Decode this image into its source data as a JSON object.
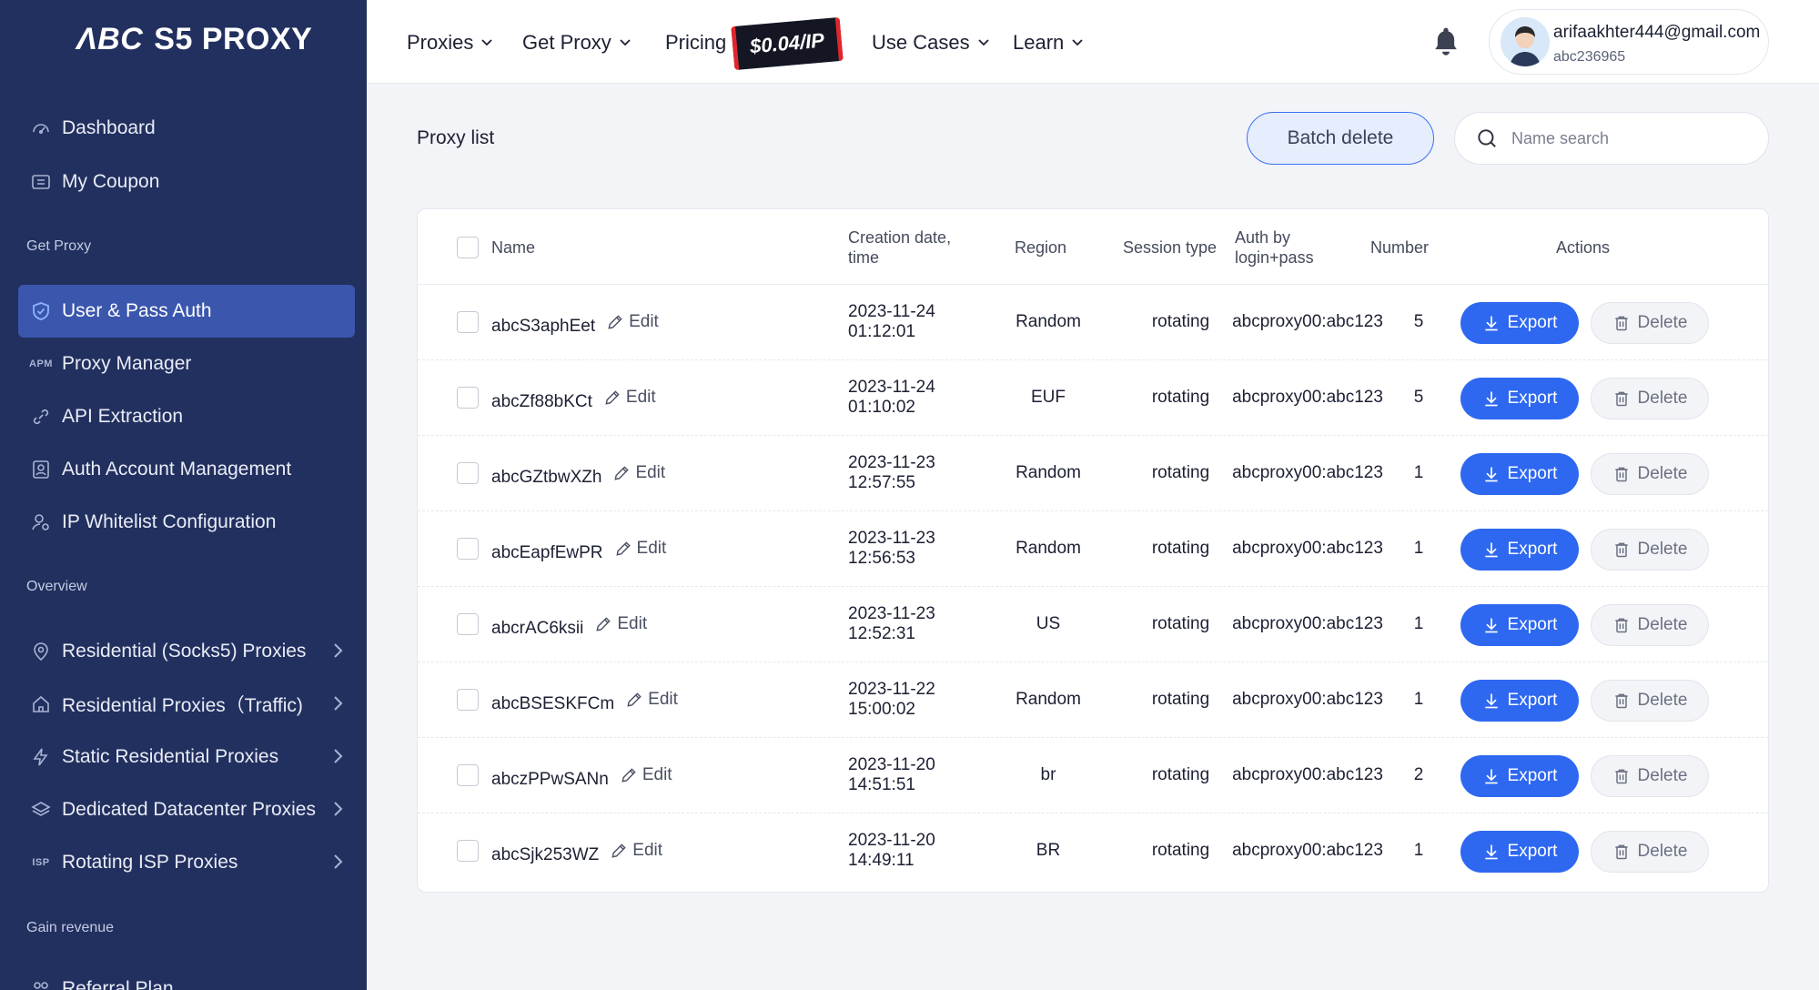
{
  "brand": {
    "logo_mark": "ΛBC",
    "logo_text": "S5 PROXY"
  },
  "sidebar": {
    "top_items": [
      {
        "label": "Dashboard",
        "icon": "gauge-icon"
      },
      {
        "label": "My Coupon",
        "icon": "coupon-icon"
      }
    ],
    "section_get_proxy": "Get Proxy",
    "get_proxy_items": [
      {
        "label": "User & Pass Auth",
        "icon": "shield-check-icon",
        "active": true
      },
      {
        "label": "Proxy Manager",
        "icon": "apm-icon",
        "icon_text": "APM"
      },
      {
        "label": "API Extraction",
        "icon": "api-link-icon"
      },
      {
        "label": "Auth Account Management",
        "icon": "account-card-icon"
      },
      {
        "label": "IP Whitelist Configuration",
        "icon": "user-gear-icon"
      }
    ],
    "section_overview": "Overview",
    "overview_items": [
      {
        "label": "Residential (Socks5) Proxies",
        "icon": "location-pin-icon"
      },
      {
        "label": "Residential Proxies（Traffic)",
        "icon": "house-icon"
      },
      {
        "label": "Static Residential Proxies",
        "icon": "bolt-icon"
      },
      {
        "label": "Dedicated Datacenter Proxies",
        "icon": "layers-icon"
      },
      {
        "label": "Rotating ISP Proxies",
        "icon": "isp-icon",
        "icon_text": "ISP"
      }
    ],
    "section_gain": "Gain revenue",
    "gain_items": [
      {
        "label": "Referral Plan",
        "icon": "referral-icon"
      }
    ]
  },
  "header": {
    "nav": [
      {
        "label": "Proxies",
        "has_dropdown": true
      },
      {
        "label": "Get Proxy",
        "has_dropdown": true
      },
      {
        "label": "Pricing",
        "has_dropdown": false
      },
      {
        "label": "Use Cases",
        "has_dropdown": true
      },
      {
        "label": "Learn",
        "has_dropdown": true
      }
    ],
    "price_badge": "$0.04/IP",
    "user_email": "arifaakhter444@gmail.com",
    "user_id": "abc236965"
  },
  "toolbar": {
    "title": "Proxy list",
    "batch_delete": "Batch delete",
    "search_placeholder": "Name search"
  },
  "table": {
    "columns": {
      "name": "Name",
      "created_l1": "Creation date,",
      "created_l2": "time",
      "region": "Region",
      "session": "Session type",
      "auth_l1": "Auth by",
      "auth_l2": "login+pass",
      "number": "Number",
      "actions": "Actions"
    },
    "edit_label": "Edit",
    "export_label": "Export",
    "delete_label": "Delete",
    "rows": [
      {
        "name": "abcS3aphEet",
        "date": "2023-11-24",
        "time": "01:12:01",
        "region": "Random",
        "session": "rotating",
        "auth": "abcproxy00:abc123",
        "number": "5"
      },
      {
        "name": "abcZf88bKCt",
        "date": "2023-11-24",
        "time": "01:10:02",
        "region": "EUF",
        "session": "rotating",
        "auth": "abcproxy00:abc123",
        "number": "5"
      },
      {
        "name": "abcGZtbwXZh",
        "date": "2023-11-23",
        "time": "12:57:55",
        "region": "Random",
        "session": "rotating",
        "auth": "abcproxy00:abc123",
        "number": "1"
      },
      {
        "name": "abcEapfEwPR",
        "date": "2023-11-23",
        "time": "12:56:53",
        "region": "Random",
        "session": "rotating",
        "auth": "abcproxy00:abc123",
        "number": "1"
      },
      {
        "name": "abcrAC6ksii",
        "date": "2023-11-23",
        "time": "12:52:31",
        "region": "US",
        "session": "rotating",
        "auth": "abcproxy00:abc123",
        "number": "1"
      },
      {
        "name": "abcBSESKFCm",
        "date": "2023-11-22",
        "time": "15:00:02",
        "region": "Random",
        "session": "rotating",
        "auth": "abcproxy00:abc123",
        "number": "1"
      },
      {
        "name": "abczPPwSANn",
        "date": "2023-11-20",
        "time": "14:51:51",
        "region": "br",
        "session": "rotating",
        "auth": "abcproxy00:abc123",
        "number": "2"
      },
      {
        "name": "abcSjk253WZ",
        "date": "2023-11-20",
        "time": "14:49:11",
        "region": "BR",
        "session": "rotating",
        "auth": "abcproxy00:abc123",
        "number": "1"
      }
    ]
  }
}
